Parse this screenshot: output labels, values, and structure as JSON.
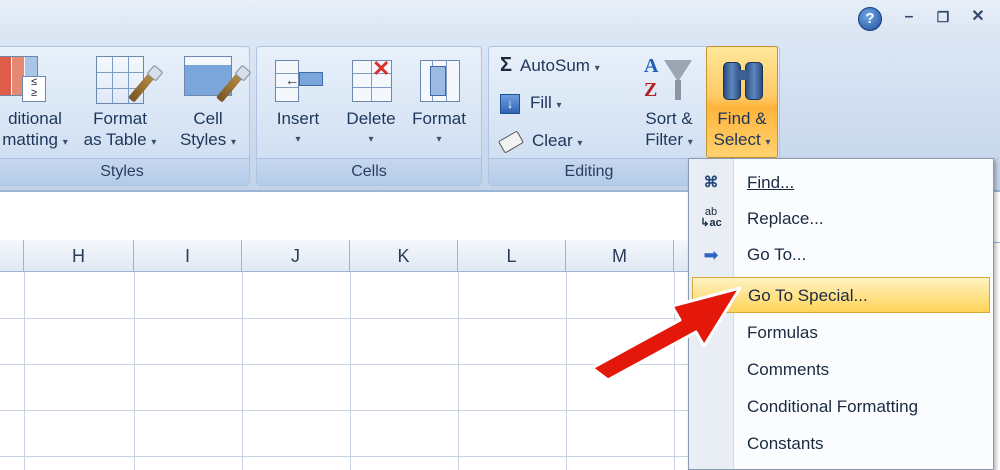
{
  "window": {
    "help_glyph": "?",
    "minimize_glyph": "–",
    "restore_glyph": "❐",
    "close_glyph": "✕"
  },
  "ribbon": {
    "styles_group": {
      "label": "Styles",
      "conditional_formatting_line1": "ditional",
      "conditional_formatting_line2": "matting",
      "format_as_table_line1": "Format",
      "format_as_table_line2": "as Table",
      "cell_styles_line1": "Cell",
      "cell_styles_line2": "Styles"
    },
    "cells_group": {
      "label": "Cells",
      "insert": "Insert",
      "delete": "Delete",
      "format": "Format"
    },
    "editing_group": {
      "label": "Editing",
      "autosum": "AutoSum",
      "fill": "Fill",
      "clear": "Clear",
      "sort_filter_line1": "Sort &",
      "sort_filter_line2": "Filter",
      "find_select_line1": "Find &",
      "find_select_line2": "Select"
    },
    "dropdown_arrow": "▾",
    "sigma": "Σ"
  },
  "columns": [
    "H",
    "I",
    "J",
    "K",
    "L",
    "M"
  ],
  "find_menu": {
    "items": [
      {
        "label": "Find...",
        "icon": "binoculars-icon",
        "glyph": "👓"
      },
      {
        "label": "Replace...",
        "icon": "replace-icon",
        "glyph": "ab"
      },
      {
        "label": "Go To...",
        "icon": "goto-arrow-icon",
        "glyph": "➡"
      },
      {
        "label": "Go To Special...",
        "icon": "",
        "glyph": ""
      },
      {
        "label": "Formulas",
        "icon": "",
        "glyph": ""
      },
      {
        "label": "Comments",
        "icon": "",
        "glyph": ""
      },
      {
        "label": "Conditional Formatting",
        "icon": "",
        "glyph": ""
      },
      {
        "label": "Constants",
        "icon": "",
        "glyph": ""
      }
    ],
    "highlighted_index": 3
  },
  "colors": {
    "ribbon_bg": "#cfdcef",
    "highlight": "#ffe38c",
    "annotation_arrow": "#e3170a"
  }
}
